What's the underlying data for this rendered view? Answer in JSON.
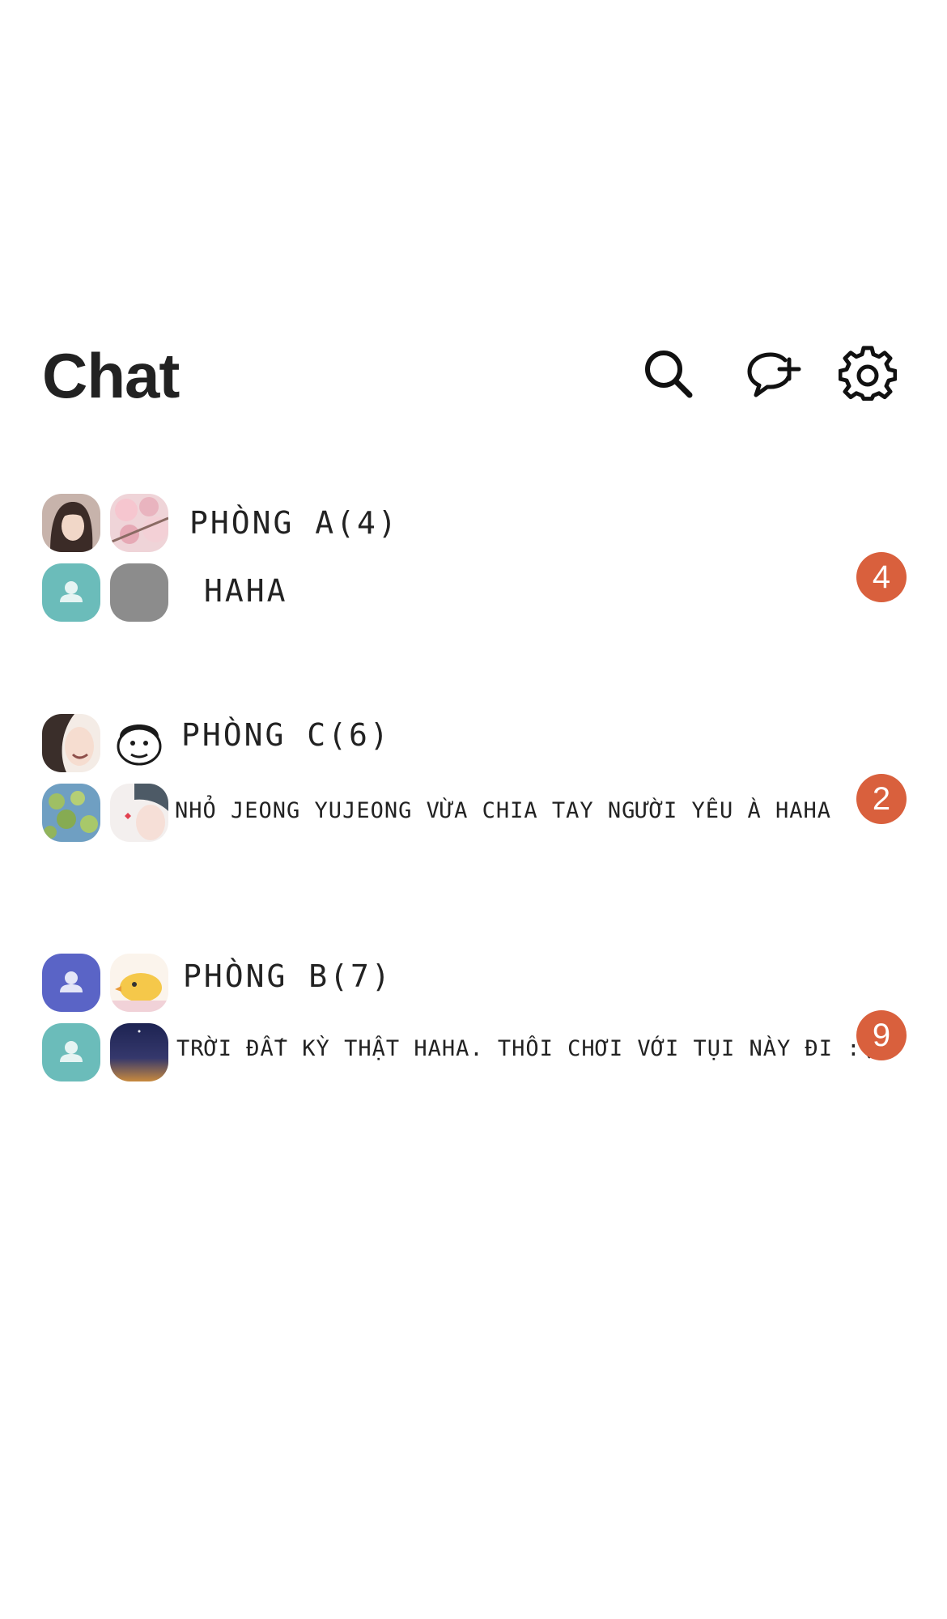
{
  "header": {
    "title": "Chat",
    "icons": {
      "search": "search-icon",
      "new_chat": "new-chat-icon",
      "settings": "gear-icon"
    }
  },
  "colors": {
    "badge": "#d9603d",
    "avatar_teal": "#6bbcba",
    "avatar_gray": "#8c8c8c",
    "avatar_indigo": "#5a64c6"
  },
  "rooms": [
    {
      "name": "PHÒNG A(4)",
      "last_message": "HAHA",
      "unread": "4",
      "avatars": [
        "girl-portrait",
        "cherry-blossom",
        "default-user-teal",
        "gray-placeholder"
      ]
    },
    {
      "name": "PHÒNG C(6)",
      "last_message": "NHỎ JEONG YUJEONG VỪA CHIA TAY NGƯỜI YÊU À HAHA",
      "unread": "2",
      "avatars": [
        "smiling-girl",
        "cartoon-face",
        "green-leaves",
        "boy-sketch"
      ]
    },
    {
      "name": "PHÒNG B(7)",
      "last_message": "TRỜI ĐẤT KỲ THẬT HAHA. THÔI CHƠI VỚI TỤI NÀY ĐI :(",
      "unread": "9",
      "avatars": [
        "default-user-indigo",
        "yellow-chick",
        "default-user-teal",
        "night-sky"
      ]
    }
  ]
}
